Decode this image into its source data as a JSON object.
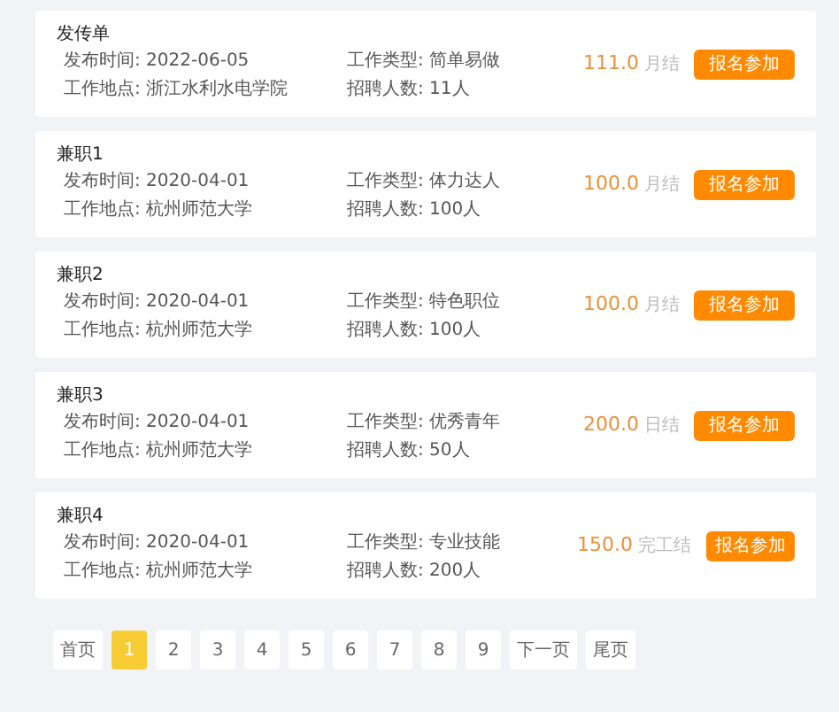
{
  "jobs": [
    {
      "title": "发传单",
      "publish_time": "发布时间: 2022-06-05",
      "job_type": "工作类型: 简单易做",
      "location": "工作地点: 浙江水利水电学院",
      "headcount": "招聘人数: 11人",
      "salary": "111.0",
      "unit": "月结",
      "button": "报名参加"
    },
    {
      "title": "兼职1",
      "publish_time": "发布时间: 2020-04-01",
      "job_type": "工作类型: 体力达人",
      "location": "工作地点: 杭州师范大学",
      "headcount": "招聘人数: 100人",
      "salary": "100.0",
      "unit": "月结",
      "button": "报名参加"
    },
    {
      "title": "兼职2",
      "publish_time": "发布时间: 2020-04-01",
      "job_type": "工作类型: 特色职位",
      "location": "工作地点: 杭州师范大学",
      "headcount": "招聘人数: 100人",
      "salary": "100.0",
      "unit": "月结",
      "button": "报名参加"
    },
    {
      "title": "兼职3",
      "publish_time": "发布时间: 2020-04-01",
      "job_type": "工作类型: 优秀青年",
      "location": "工作地点: 杭州师范大学",
      "headcount": "招聘人数: 50人",
      "salary": "200.0",
      "unit": "日结",
      "button": "报名参加"
    },
    {
      "title": "兼职4",
      "publish_time": "发布时间: 2020-04-01",
      "job_type": "工作类型: 专业技能",
      "location": "工作地点: 杭州师范大学",
      "headcount": "招聘人数: 200人",
      "salary": "150.0",
      "unit": "完工结",
      "button": "报名参加"
    }
  ],
  "pagination": [
    {
      "label": "首页",
      "selected": false
    },
    {
      "label": "1",
      "selected": true
    },
    {
      "label": "2",
      "selected": false
    },
    {
      "label": "3",
      "selected": false
    },
    {
      "label": "4",
      "selected": false
    },
    {
      "label": "5",
      "selected": false
    },
    {
      "label": "6",
      "selected": false
    },
    {
      "label": "7",
      "selected": false
    },
    {
      "label": "8",
      "selected": false
    },
    {
      "label": "9",
      "selected": false
    },
    {
      "label": "下一页",
      "selected": false
    },
    {
      "label": "尾页",
      "selected": false
    }
  ]
}
